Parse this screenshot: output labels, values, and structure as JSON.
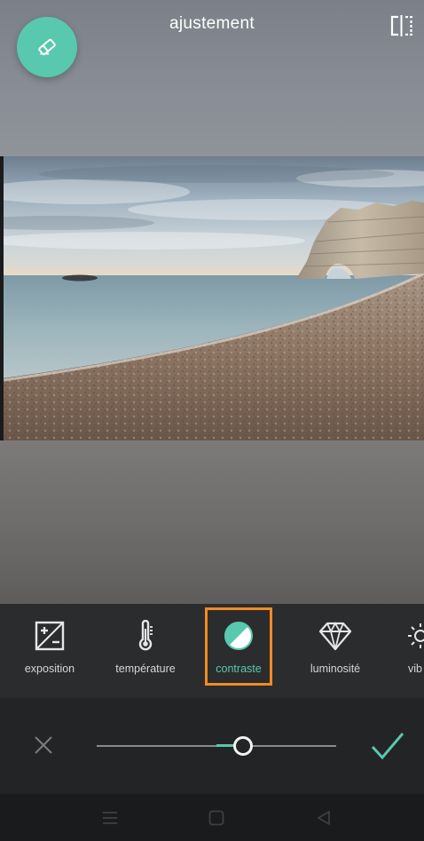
{
  "header": {
    "title": "ajustement",
    "eraser_icon": "eraser-icon",
    "compare_icon": "compare-split-icon"
  },
  "tools": {
    "items": [
      {
        "label": "exposition",
        "icon": "exposure-icon",
        "active": false
      },
      {
        "label": "température",
        "icon": "thermometer-icon",
        "active": false
      },
      {
        "label": "contraste",
        "icon": "contrast-icon",
        "active": true
      },
      {
        "label": "luminosité",
        "icon": "diamond-icon",
        "active": false
      },
      {
        "label": "vib",
        "icon": "sun-icon",
        "active": false
      }
    ]
  },
  "slider": {
    "value_fraction": 0.61,
    "center_fraction": 0.5,
    "cancel_icon": "close-icon",
    "apply_icon": "checkmark-icon"
  },
  "nav": {
    "menu_icon": "menu-icon",
    "home_icon": "home-square-icon",
    "back_icon": "back-triangle-icon"
  },
  "colors": {
    "accent": "#58c8ae",
    "highlight": "#f28a24",
    "toolbar_bg": "#2b2c2e",
    "slider_bg": "#232426"
  }
}
